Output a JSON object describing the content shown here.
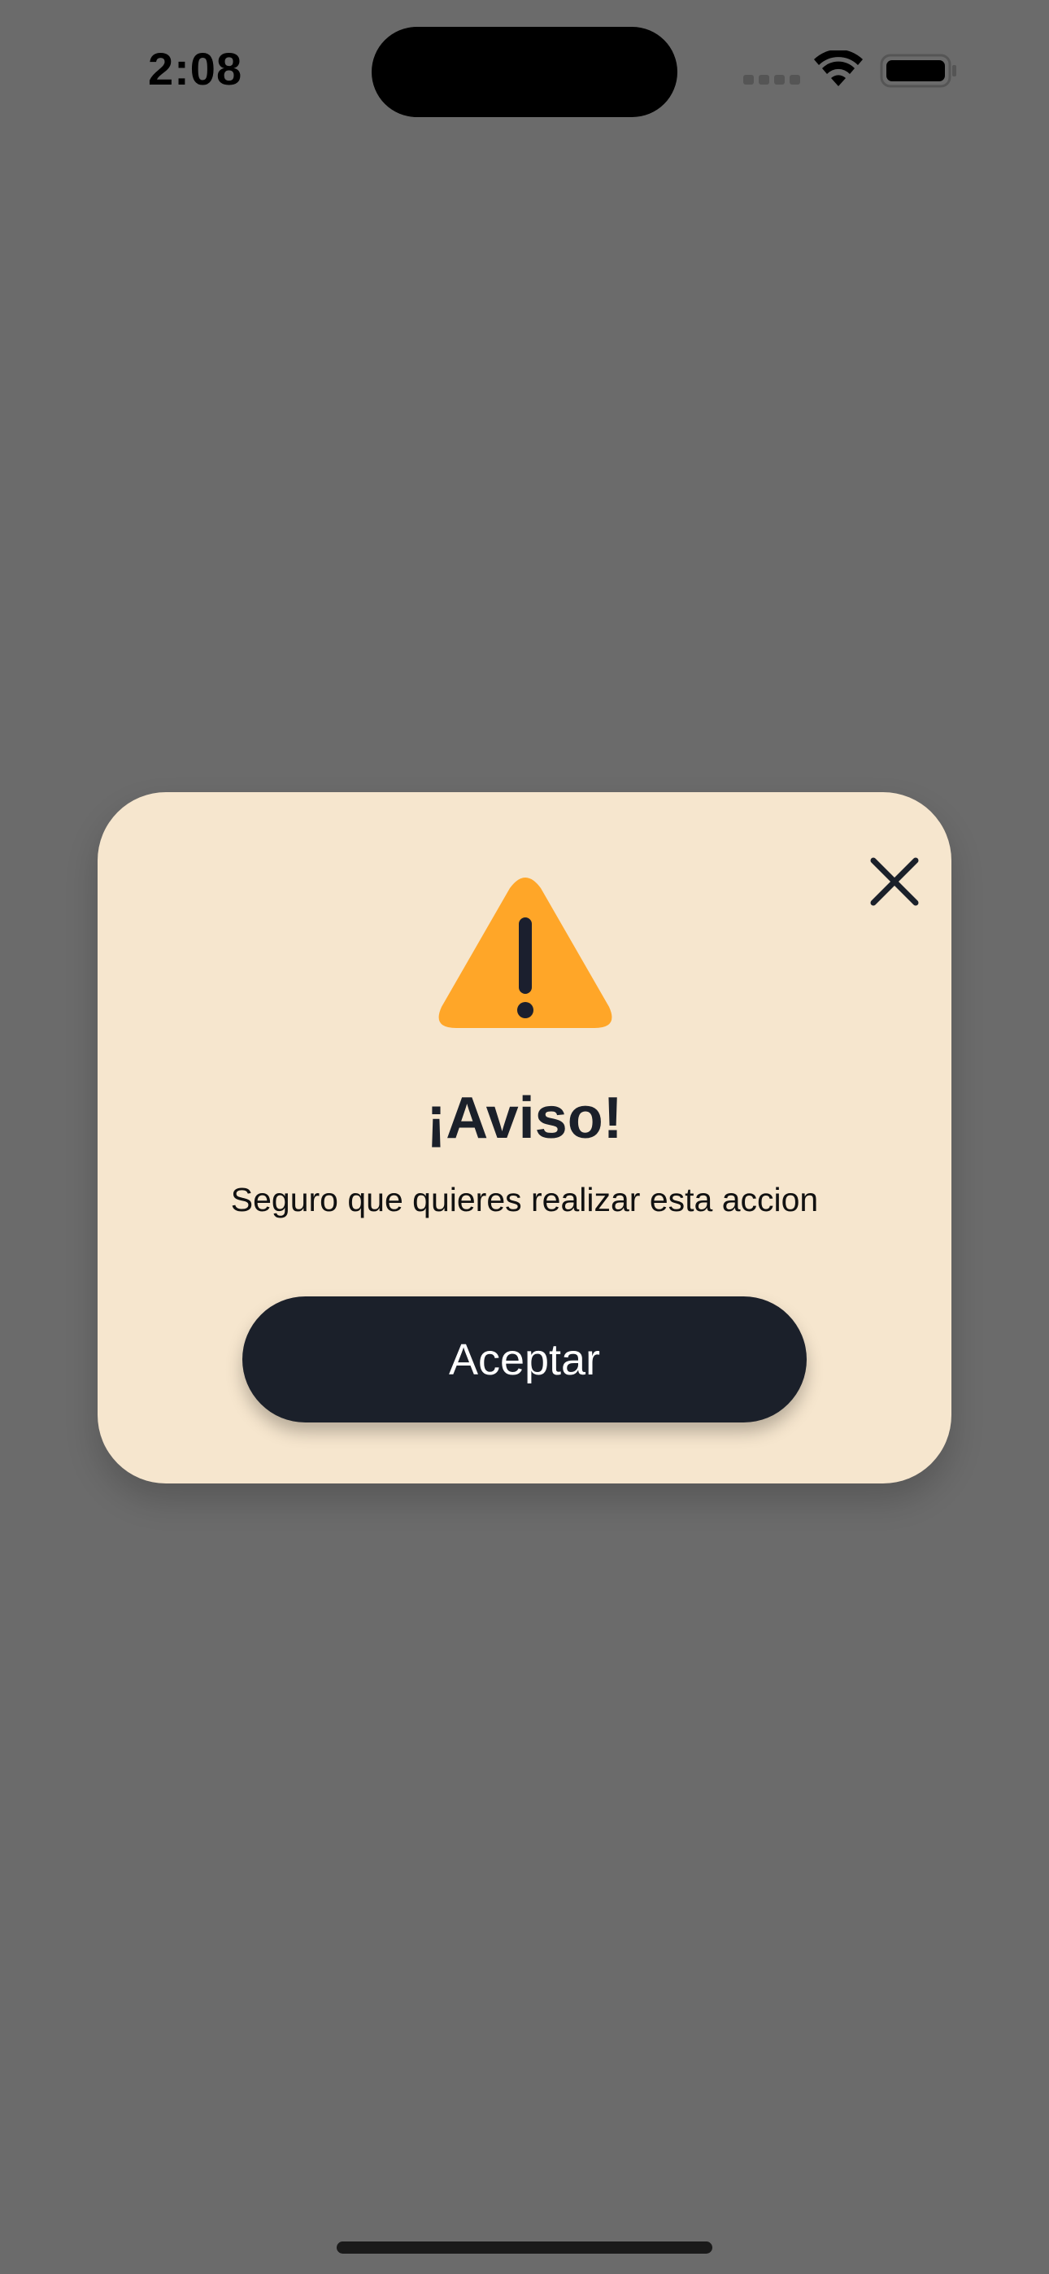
{
  "status_bar": {
    "time": "2:08",
    "icons": [
      "cellular-signal-icon",
      "wifi-icon",
      "battery-icon"
    ]
  },
  "dialog": {
    "icon": "warning-triangle-icon",
    "close_icon": "close-icon",
    "title": "¡Aviso!",
    "message": "Seguro que quieres realizar esta accion",
    "accept_label": "Aceptar"
  },
  "colors": {
    "overlay": "#6b6b6b",
    "dialog_background": "#f6e6ce",
    "warning": "#ffa628",
    "button_background": "#1b202a",
    "button_text": "#ffffff"
  }
}
